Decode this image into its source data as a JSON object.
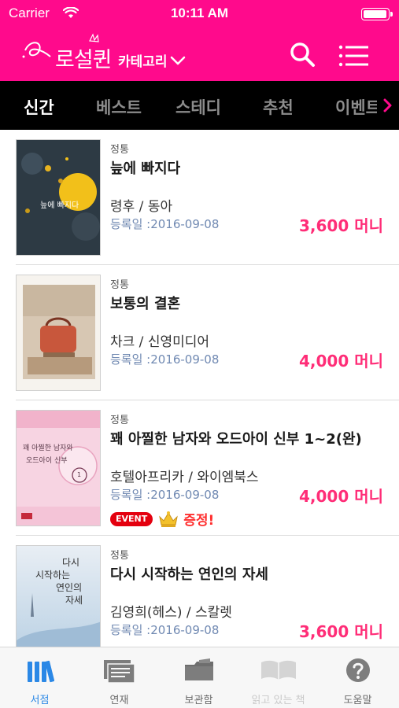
{
  "status_bar": {
    "carrier": "Carrier",
    "time": "10:11 AM",
    "battery_level": 1.0
  },
  "header": {
    "logo_text": "로설퀸",
    "category_label": "카테고리",
    "background_color": "#ff0a8c",
    "icons": [
      "search-icon",
      "menu-icon",
      "chevron-down-icon"
    ]
  },
  "tabs": [
    {
      "label": "신간",
      "active": true
    },
    {
      "label": "베스트",
      "active": false
    },
    {
      "label": "스테디",
      "active": false
    },
    {
      "label": "추천",
      "active": false
    },
    {
      "label": "이벤트",
      "active": false
    }
  ],
  "books": [
    {
      "genre": "정통",
      "title": "늪에 빠지다",
      "author": "령후 / 동아",
      "date": "등록일 :2016-09-08",
      "price": "3,600 머니",
      "event": null,
      "gift": null
    },
    {
      "genre": "정통",
      "title": "보통의 결혼",
      "author": "차크 / 신영미디어",
      "date": "등록일 :2016-09-08",
      "price": "4,000 머니",
      "event": null,
      "gift": null
    },
    {
      "genre": "정통",
      "title": "꽤 아찔한 남자와 오드아이 신부 1~2(완)",
      "author": "호텔아프리카 / 와이엠북스",
      "date": "등록일 :2016-09-08",
      "price": "4,000 머니",
      "event": "EVENT",
      "gift": "증정!"
    },
    {
      "genre": "정통",
      "title": "다시 시작하는 연인의 자세",
      "author": "김영희(헤스) / 스칼렛",
      "date": "등록일 :2016-09-08",
      "price": "3,600 머니",
      "event": null,
      "gift": null
    }
  ],
  "covers": {
    "book1": {
      "text_line": "늪에 빠지다"
    },
    "book3": {
      "text_line1": "꽤 아찔한 남자와",
      "text_line2": "오드아이 신부",
      "number": "1"
    },
    "book4": {
      "text_line1": "다시",
      "text_line2": "시작하는",
      "text_line3": "연인의",
      "text_line4": "자세"
    }
  },
  "bottom_tabs": [
    {
      "label": "서점",
      "state": "active",
      "icon": "books-icon"
    },
    {
      "label": "연재",
      "state": "normal",
      "icon": "serial-icon"
    },
    {
      "label": "보관함",
      "state": "normal",
      "icon": "folder-icon"
    },
    {
      "label": "읽고 있는 책",
      "state": "disabled",
      "icon": "open-book-icon"
    },
    {
      "label": "도움말",
      "state": "normal",
      "icon": "help-icon"
    }
  ],
  "colors": {
    "accent_pink": "#ff0a8c",
    "price_pink": "#ff2d77",
    "active_blue": "#2b88e6",
    "tab_bar_black": "#000000"
  }
}
